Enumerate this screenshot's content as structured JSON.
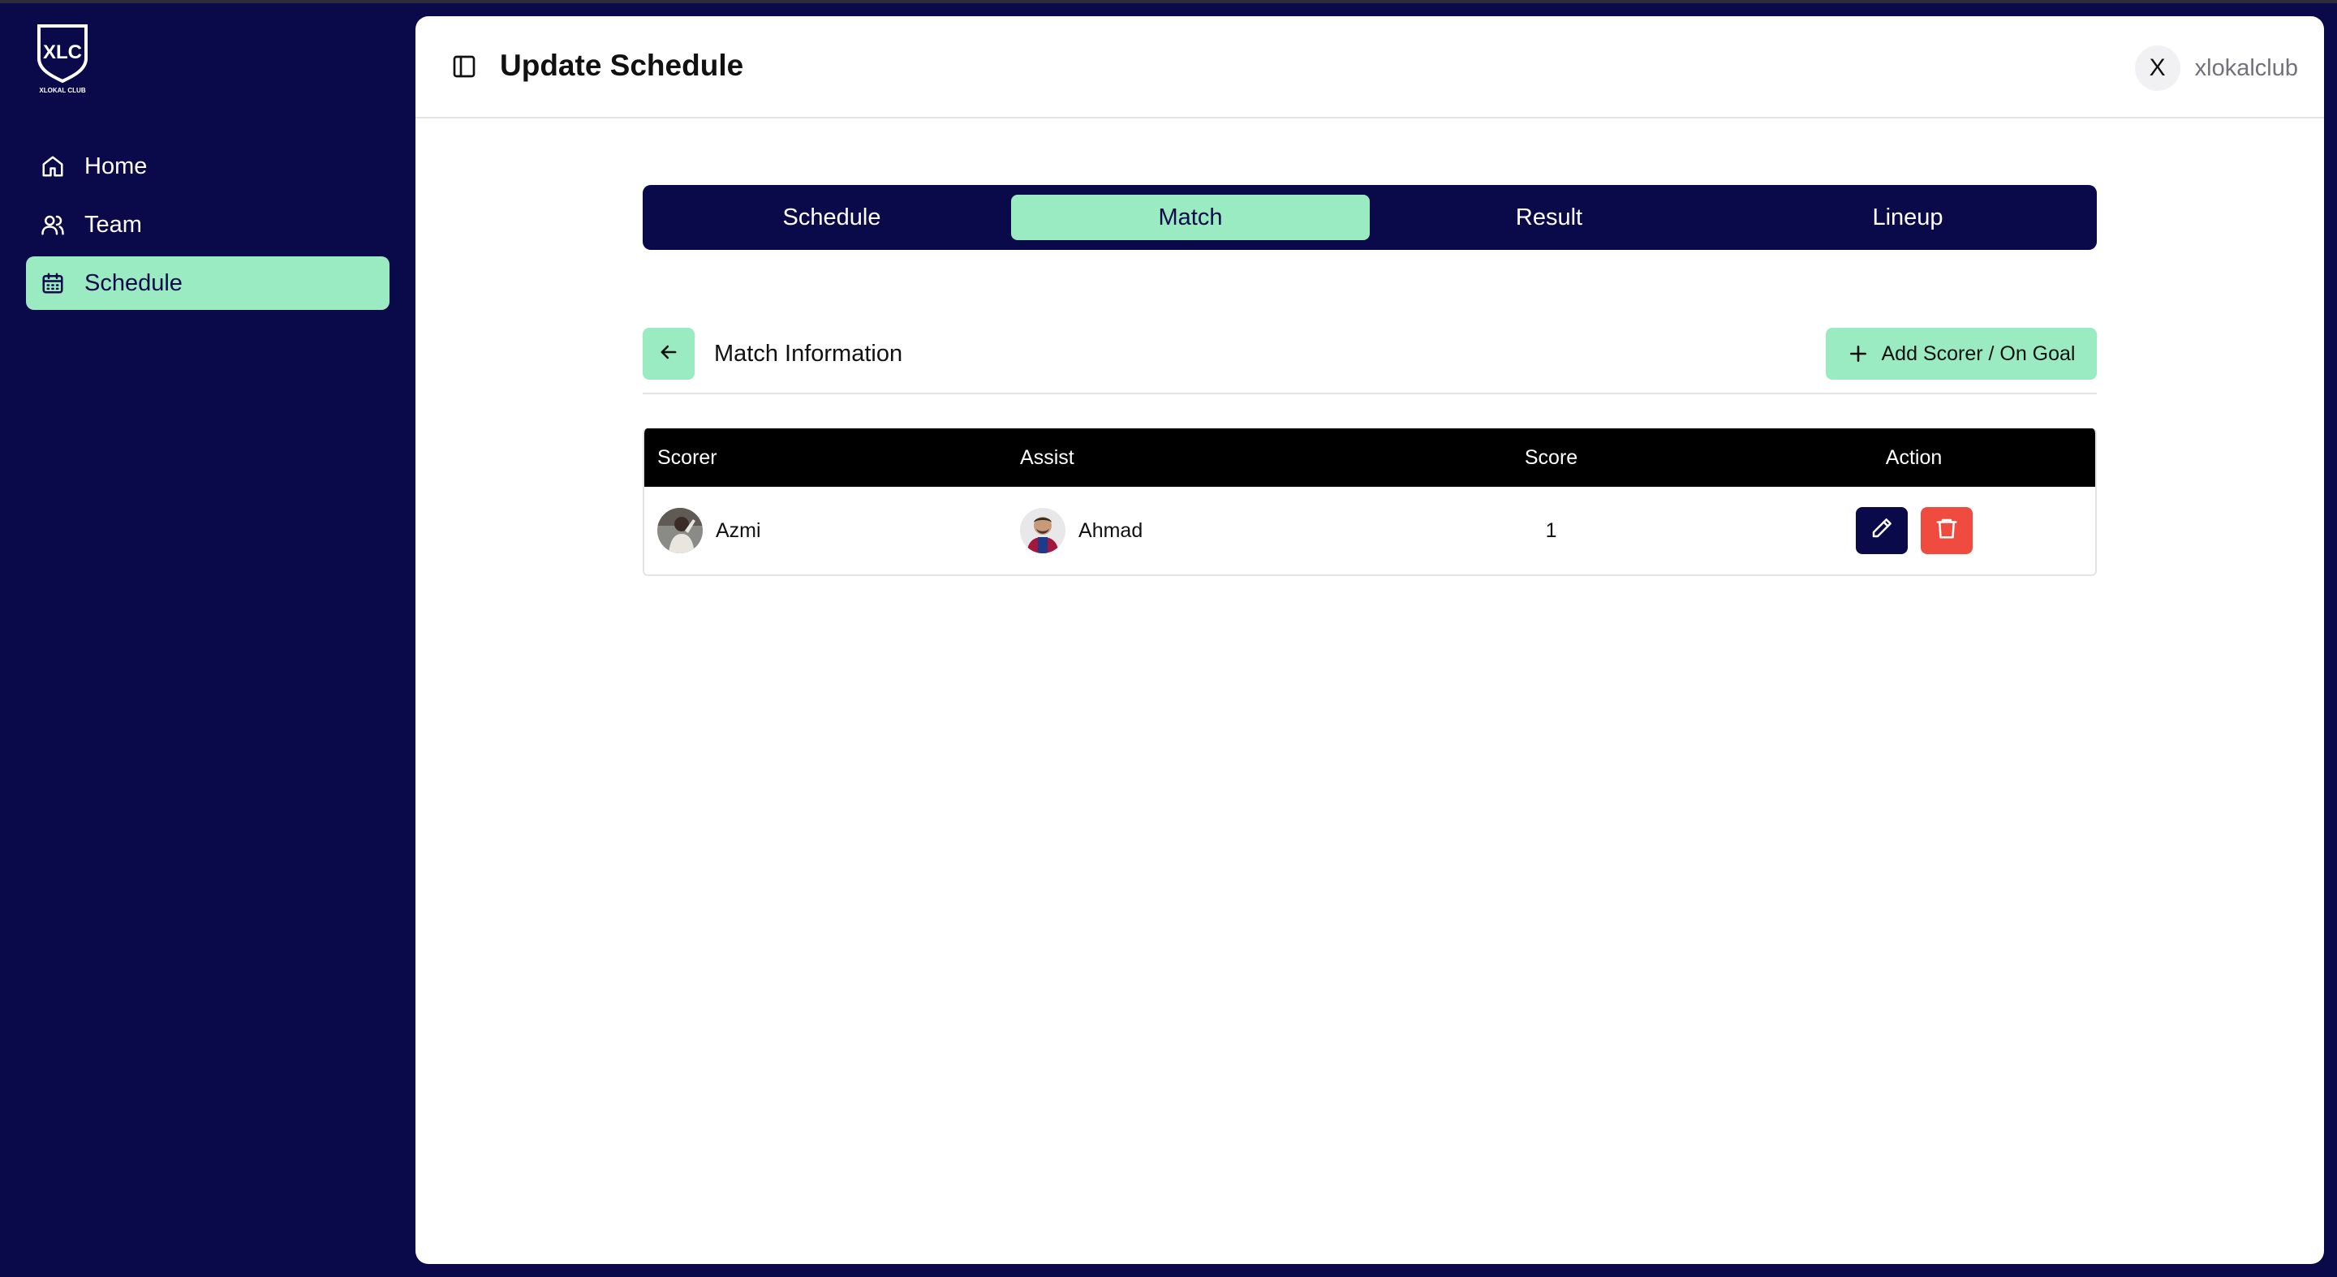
{
  "app": {
    "logo_text": "XLC",
    "logo_sub": "XLOKAL CLUB"
  },
  "sidebar": {
    "items": [
      {
        "label": "Home",
        "icon": "home-icon",
        "active": false
      },
      {
        "label": "Team",
        "icon": "users-icon",
        "active": false
      },
      {
        "label": "Schedule",
        "icon": "calendar-icon",
        "active": true
      }
    ]
  },
  "header": {
    "title": "Update Schedule",
    "user_initial": "X",
    "username": "xlokalclub"
  },
  "tabs": [
    {
      "label": "Schedule",
      "active": false
    },
    {
      "label": "Match",
      "active": true
    },
    {
      "label": "Result",
      "active": false
    },
    {
      "label": "Lineup",
      "active": false
    }
  ],
  "section": {
    "title": "Match Information",
    "add_label": "Add Scorer / On Goal"
  },
  "table": {
    "columns": [
      "Scorer",
      "Assist",
      "Score",
      "Action"
    ],
    "rows": [
      {
        "scorer": "Azmi",
        "assist": "Ahmad",
        "score": "1"
      }
    ]
  },
  "colors": {
    "navy": "#0a0a4a",
    "mint": "#9aebc2",
    "danger": "#ef4c3f"
  }
}
